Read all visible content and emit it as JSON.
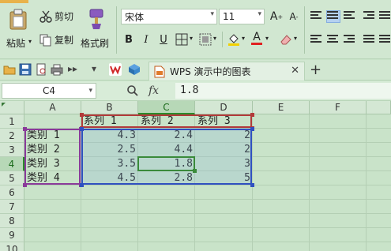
{
  "ribbon": {
    "paste_label": "粘贴",
    "cut_label": "剪切",
    "copy_label": "复制",
    "format_painter_label": "格式刷",
    "font_name": "宋体",
    "font_size": "11",
    "grow_font": "A",
    "shrink_font": "A",
    "bold": "B",
    "italic": "I",
    "underline": "U",
    "font_color_letter": "A"
  },
  "tabbar": {
    "doc_tab_label": "WPS 演示中的图表",
    "plus": "+"
  },
  "formula_bar": {
    "cell_ref": "C4",
    "fx": "fx",
    "value": "1.8"
  },
  "grid": {
    "columns": [
      "A",
      "B",
      "C",
      "D",
      "E",
      "F"
    ],
    "rows": [
      "1",
      "2",
      "3",
      "4",
      "5",
      "6",
      "7",
      "8",
      "9",
      "10"
    ],
    "active_column": "C",
    "active_row": "4",
    "headers": [
      "系列 1",
      "系列 2",
      "系列 3"
    ],
    "categories": [
      "类别 1",
      "类别 2",
      "类别 3",
      "类别 4"
    ],
    "values": [
      [
        "4.3",
        "2.4",
        "2"
      ],
      [
        "2.5",
        "4.4",
        "2"
      ],
      [
        "3.5",
        "1.8",
        "3"
      ],
      [
        "4.5",
        "2.8",
        "5"
      ]
    ]
  },
  "colors": {
    "ribbon_bg": "#d1e7d1",
    "grid_bg": "#c9e3c9",
    "series_range": "#b23a3a",
    "category_range": "#8a3a9a",
    "data_range": "#3050c0",
    "active_cell": "#3a8a3a"
  }
}
